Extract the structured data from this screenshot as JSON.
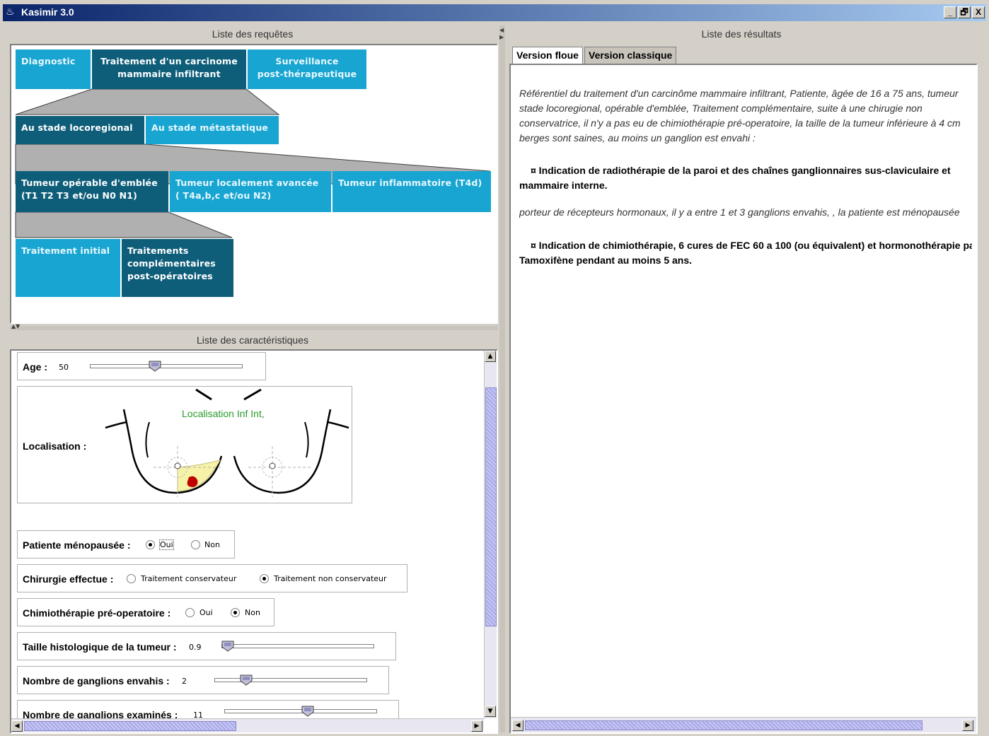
{
  "window": {
    "title": "Kasimir 3.0",
    "buttons": [
      "_",
      "🗗",
      "X"
    ]
  },
  "requetes": {
    "title": "Liste des requêtes",
    "row1": [
      "Diagnostic",
      "Traitement d'un carcinome\nmammaire infiltrant",
      "Surveillance\npost-thérapeutique"
    ],
    "row2": [
      "Au stade locoregional",
      "Au stade métastatique"
    ],
    "row3": [
      "Tumeur opérable d'emblée\n(T1 T2 T3 et/ou N0 N1)",
      "Tumeur localement avancée\n( T4a,b,c et/ou N2)",
      "Tumeur inflammatoire (T4d)"
    ],
    "row4": [
      "Traitement initial",
      "Traitements\ncomplémentaires\npost-opératoires"
    ]
  },
  "caracteristiques": {
    "title": "Liste des caractéristiques",
    "age": {
      "label": "Age :",
      "value": "50",
      "level": 0.42
    },
    "localisation": {
      "label": "Localisation :",
      "caption": "Localisation Inf Int,"
    },
    "menopause": {
      "label": "Patiente ménopausée :",
      "options": [
        "Oui",
        "Non"
      ],
      "selected": "Oui"
    },
    "chirurgie": {
      "label": "Chirurgie effectue :",
      "options": [
        "Traitement conservateur",
        "Traitement non conservateur"
      ],
      "selected": "Traitement non conservateur"
    },
    "chimio": {
      "label": "Chimiothérapie pré-operatoire :",
      "options": [
        "Oui",
        "Non"
      ],
      "selected": "Non"
    },
    "taille": {
      "label": "Taille histologique de la tumeur :",
      "value": "0.9",
      "level": 0.0
    },
    "ganglions_envahis": {
      "label": "Nombre de ganglions envahis :",
      "value": "2",
      "level": 0.18
    },
    "ganglions_examines": {
      "label": "Nombre de ganglions examinés :",
      "value": "11",
      "level": 0.55
    }
  },
  "resultats": {
    "title": "Liste des résultats",
    "tabs": [
      "Version floue",
      "Version classique"
    ],
    "active_tab": "Version floue",
    "lines": [
      "Référentiel du traitement d'un carcinôme mammaire infiltrant, Patiente, âgée de 16 a 75 ans, tumeur",
      "stade locoregional, opérable d'emblée, Traitement complémentaire, suite à une chirugie non",
      "conservatrice, il n'y a pas eu de chimiothérapie pré-operatoire, la taille de la tumeur inférieure à 4 cm",
      "berges sont saines, au moins un ganglion est envahi :",
      "¤ Indication de radiothérapie de la paroi et des chaînes ganglionnaires sus-claviculaire et",
      "mammaire interne.",
      "porteur de récepteurs hormonaux, il y a entre 1 et 3 ganglions envahis, , la patiente est ménopausée",
      "¤ Indication de chimiothérapie, 6 cures de FEC 60 a 100 (ou équivalent) et hormonothérapie par",
      "Tamoxifène pendant au moins 5 ans."
    ]
  },
  "colors": {
    "selected_node": "#0e5e7a",
    "unselected_node": "#18a5d1",
    "caption_green": "#2a9a2a",
    "tumor": "#c00000",
    "zone": "#f6f2a8"
  }
}
